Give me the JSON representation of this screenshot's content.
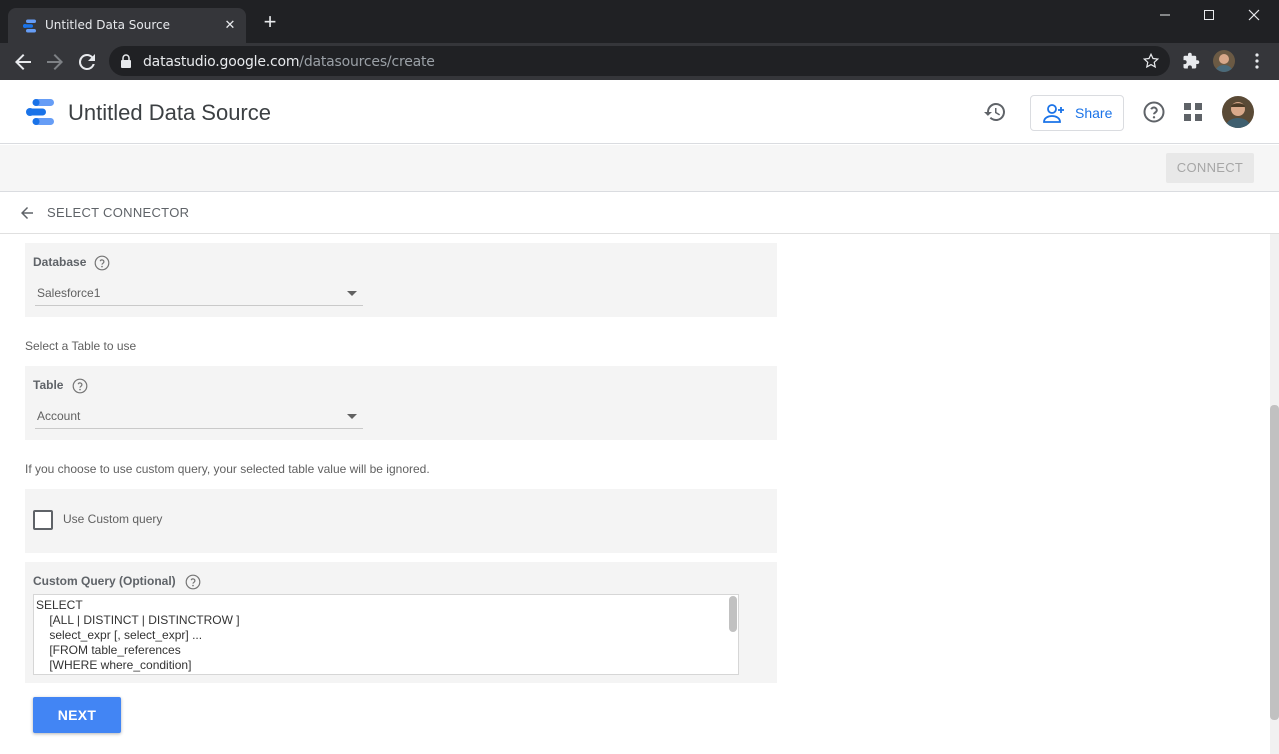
{
  "browser": {
    "tab_title": "Untitled Data Source",
    "url_host": "datastudio.google.com",
    "url_path": "/datasources/create"
  },
  "app": {
    "title": "Untitled Data Source",
    "share_label": "Share",
    "connect_label": "CONNECT",
    "select_connector_label": "SELECT CONNECTOR"
  },
  "form": {
    "database": {
      "label": "Database",
      "value": "Salesforce1"
    },
    "table_hint": "Select a Table to use",
    "table": {
      "label": "Table",
      "value": "Account"
    },
    "custom_query_hint": "If you choose to use custom query, your selected table value will be ignored.",
    "use_custom_query_label": "Use Custom query",
    "use_custom_query_checked": false,
    "custom_query_label": "Custom Query (Optional)",
    "custom_query_text": "SELECT\n    [ALL | DISTINCT | DISTINCTROW ]\n    select_expr [, select_expr] ...\n    [FROM table_references\n    [WHERE where_condition]",
    "next_label": "NEXT"
  },
  "colors": {
    "accent": "#4285f4",
    "link": "#1a73e8",
    "chrome_dark": "#202124",
    "chrome_tab": "#35363a",
    "panel_bg": "#f4f4f4"
  },
  "icons": [
    "datastudio-logo-icon",
    "lock-icon",
    "star-icon",
    "extensions-icon",
    "history-icon",
    "add-person-icon",
    "help-icon",
    "apps-grid-icon",
    "back-arrow-icon"
  ]
}
